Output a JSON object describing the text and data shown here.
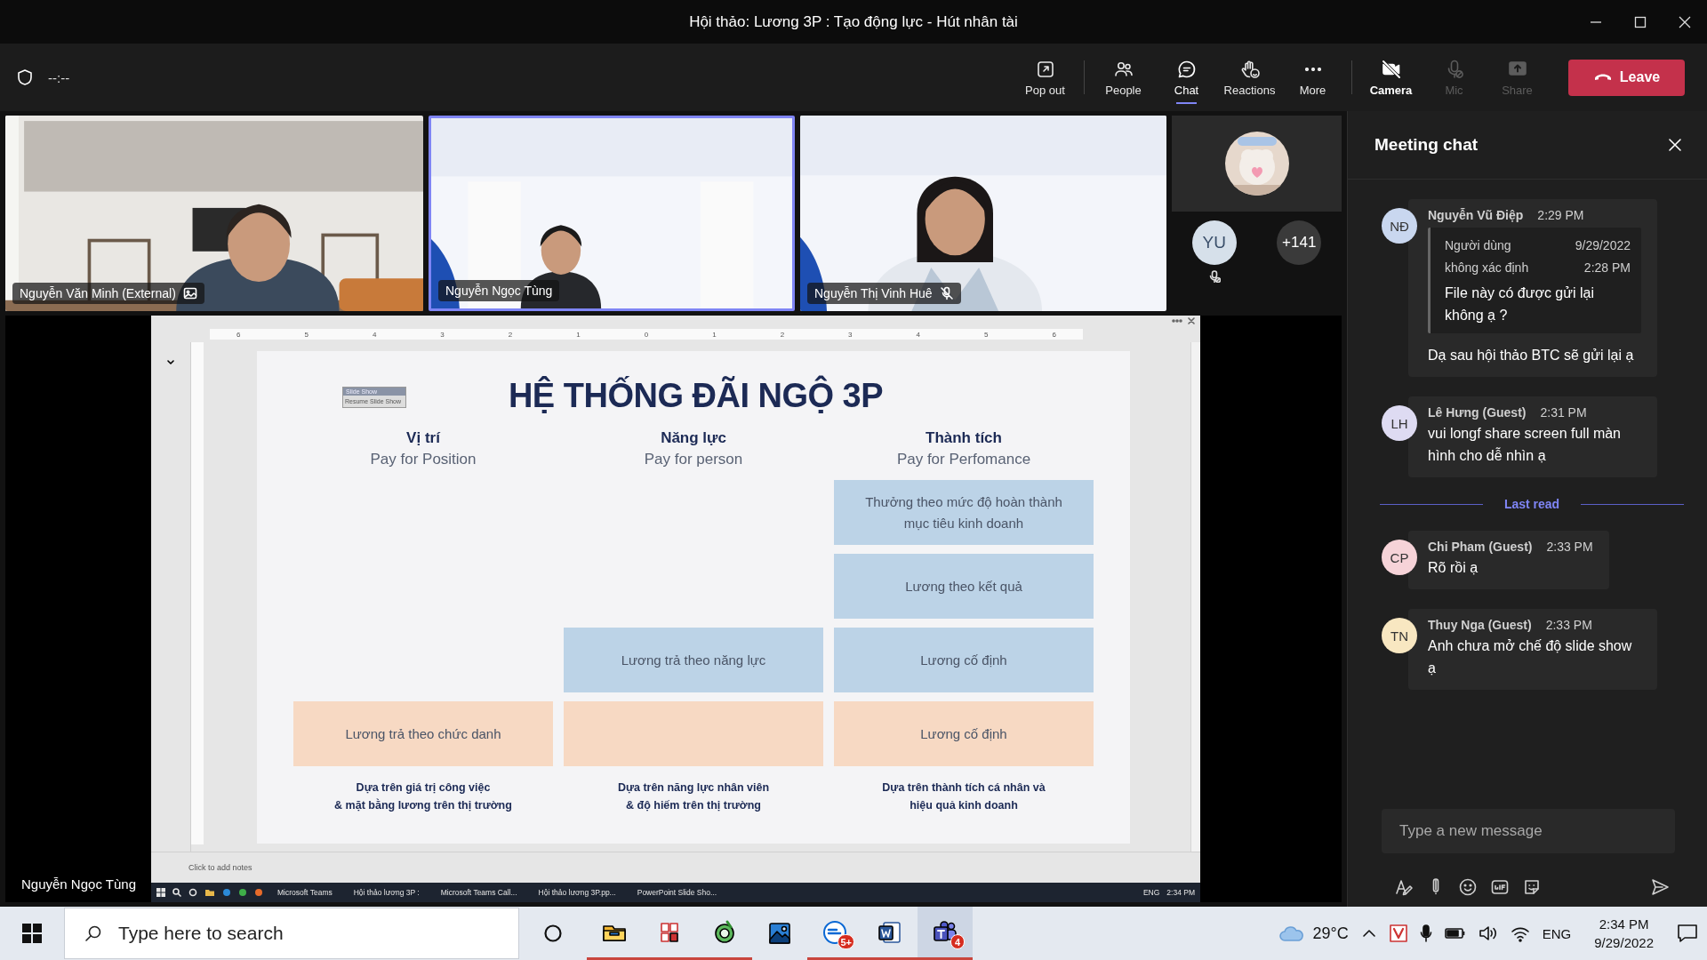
{
  "window": {
    "title": "Hội thảo: Lương 3P : Tạo động lực - Hút nhân tài"
  },
  "toolbar": {
    "timer": "--:--",
    "view_buttons": [
      {
        "kind": "popout",
        "label": "Pop out",
        "selected": false
      },
      {
        "kind": "people",
        "label": "People",
        "selected": false
      },
      {
        "kind": "chat",
        "label": "Chat",
        "selected": true
      },
      {
        "kind": "reactions",
        "label": "Reactions",
        "selected": false
      },
      {
        "kind": "more",
        "label": "More",
        "selected": false
      }
    ],
    "device_buttons": [
      {
        "kind": "camera",
        "label": "Camera",
        "disabled": false
      },
      {
        "kind": "mic",
        "label": "Mic",
        "disabled": true
      },
      {
        "kind": "share",
        "label": "Share",
        "disabled": true
      }
    ],
    "leave": {
      "label": "Leave"
    }
  },
  "participants": [
    {
      "name": "Nguyễn Văn Minh (External)",
      "selected": false,
      "image_badge": true,
      "muted": false
    },
    {
      "name": "Nguyễn Ngọc Tùng",
      "selected": true,
      "image_badge": false,
      "muted": false
    },
    {
      "name": "Nguyễn Thị Vinh Huê",
      "selected": false,
      "image_badge": false,
      "muted": true
    }
  ],
  "roster": {
    "avatar": {
      "initials": "YU",
      "muted": true
    },
    "overflow": "+141"
  },
  "stage": {
    "presenter": "Nguyễn Ngọc Tùng",
    "ruler": [
      "6",
      "5",
      "4",
      "3",
      "2",
      "1",
      "0",
      "1",
      "2",
      "3",
      "4",
      "5",
      "6"
    ],
    "slideshow_bar": {
      "title": "Slide Show",
      "action": "Resume Slide Show"
    },
    "slide": {
      "title": "HỆ THỐNG ĐÃI NGỘ 3P",
      "columns": [
        {
          "heading": "Vị trí",
          "subheading": "Pay for Position",
          "blocks": [
            {
              "kind": "fixed",
              "text": "Lương trả theo chức danh"
            }
          ],
          "footer": "Dựa trên giá trị công việc\n& mặt bằng lương trên thị trường"
        },
        {
          "heading": "Năng lực",
          "subheading": "Pay for person",
          "blocks": [
            {
              "kind": "variable",
              "text": "Lương trả theo năng lực"
            },
            {
              "kind": "fixed"
            }
          ],
          "footer": "Dựa trên năng lực nhân viên\n& độ hiếm trên thị trường"
        },
        {
          "heading": "Thành tích",
          "subheading": "Pay for Perfomance",
          "blocks": [
            {
              "kind": "variable",
              "text": "Thưởng theo mức độ hoàn thành mục tiêu kinh doanh"
            },
            {
              "kind": "variable",
              "text": "Lương theo kết quả"
            },
            {
              "kind": "variable",
              "text": "Lương cố định"
            },
            {
              "kind": "fixed",
              "text": "Lương cố định"
            }
          ],
          "footer": "Dựa trên thành tích cá nhân và\nhiệu quả kinh doanh"
        }
      ]
    },
    "notes_placeholder": "Click to add notes",
    "taskbar": {
      "items": [
        "Microsoft Teams",
        "Hội thảo lương 3P :",
        "Microsoft Teams Call...",
        "Hội thảo lương 3P.pp...",
        "PowerPoint Slide Sho..."
      ],
      "language": "ENG",
      "time": "2:34 PM"
    }
  },
  "chat": {
    "title": "Meeting chat",
    "entries": [
      {
        "kind": "message",
        "initials": "NĐ",
        "color": "#c9d7ef",
        "author": "Nguyễn Vũ Điệp",
        "time": "2:29 PM",
        "quote": {
          "author": "Người dùng không xác định",
          "date": "9/29/2022",
          "time": "2:28 PM",
          "text": "File này có được gửi lại không ạ ?"
        },
        "text": "Dạ sau hội thảo BTC sẽ gửi lại ạ"
      },
      {
        "kind": "message",
        "initials": "LH",
        "color": "#dedbf2",
        "author": "Lê Hưng (Guest)",
        "time": "2:31 PM",
        "text": "vui longf share screen full màn hình cho dễ nhìn ạ"
      },
      {
        "kind": "divider",
        "text": "Last read"
      },
      {
        "kind": "message",
        "initials": "CP",
        "color": "#f6d3d8",
        "author": "Chi Pham (Guest)",
        "time": "2:33 PM",
        "text": "Rõ rồi ạ"
      },
      {
        "kind": "message",
        "initials": "TN",
        "color": "#f8e7c1",
        "author": "Thuy Nga (Guest)",
        "time": "2:33 PM",
        "text": "Anh chưa mở chế độ slide show ạ"
      }
    ],
    "composer": {
      "placeholder": "Type a new message"
    }
  },
  "taskbar": {
    "search_placeholder": "Type here to search",
    "apps": [
      {
        "kind": "explorer",
        "running": true,
        "selected": false
      },
      {
        "kind": "notes",
        "running": true,
        "selected": false
      },
      {
        "kind": "green",
        "running": true,
        "selected": false
      },
      {
        "kind": "photos",
        "running": false,
        "selected": false
      },
      {
        "kind": "zalo",
        "running": true,
        "selected": false,
        "badge": "5+"
      },
      {
        "kind": "word",
        "running": true,
        "selected": false
      },
      {
        "kind": "teams",
        "running": true,
        "selected": true,
        "badge": "4"
      }
    ],
    "weather": "29°C",
    "language": "ENG",
    "time": "2:34 PM",
    "date": "9/29/2022"
  }
}
